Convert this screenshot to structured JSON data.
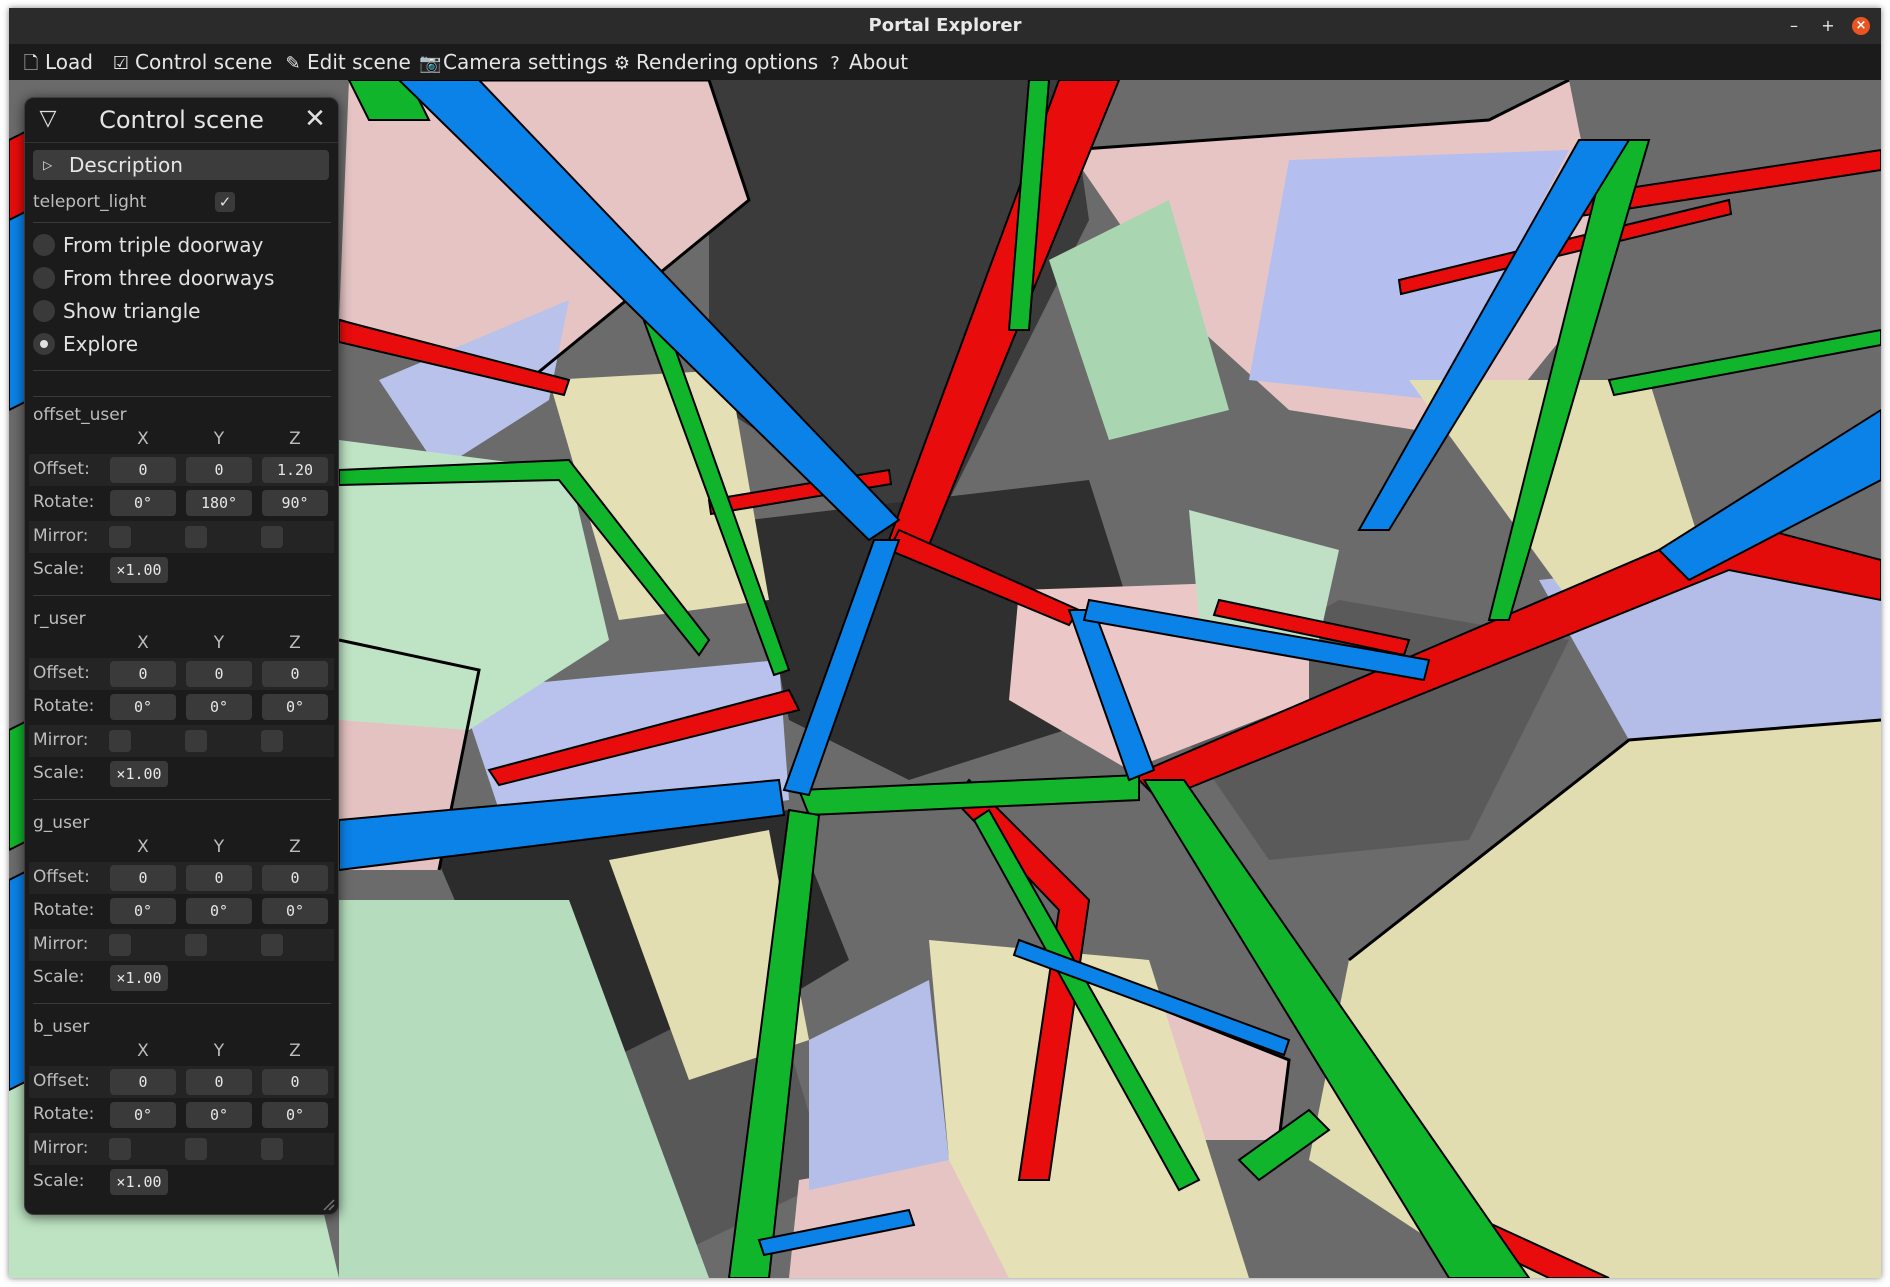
{
  "window": {
    "title": "Portal Explorer",
    "minimize_label": "–",
    "maximize_label": "+",
    "close_label": "×"
  },
  "menu": {
    "items": [
      {
        "label": "Load",
        "icon": "document-icon",
        "glyph": "🗋"
      },
      {
        "label": "Control scene",
        "icon": "checkbox-icon",
        "glyph": "☑"
      },
      {
        "label": "Edit scene",
        "icon": "pencil-icon",
        "glyph": "✎"
      },
      {
        "label": "Camera settings",
        "icon": "camera-icon",
        "glyph": "📷"
      },
      {
        "label": "Rendering options",
        "icon": "gear-icon",
        "glyph": "⚙"
      },
      {
        "label": "About",
        "icon": "question-icon",
        "glyph": "?"
      }
    ]
  },
  "panel": {
    "title": "Control scene",
    "collapse_glyph": "▽",
    "close_glyph": "✕",
    "description_label": "Description",
    "description_glyph": "▷",
    "teleport_light": {
      "label": "teleport_light",
      "checked": true,
      "glyph": "✓"
    },
    "radios": [
      {
        "label": "From triple doorway",
        "selected": false
      },
      {
        "label": "From three doorways",
        "selected": false
      },
      {
        "label": "Show triangle",
        "selected": false
      },
      {
        "label": "Explore",
        "selected": true
      }
    ],
    "axes": [
      "X",
      "Y",
      "Z"
    ],
    "row_labels": {
      "offset": "Offset:",
      "rotate": "Rotate:",
      "mirror": "Mirror:",
      "scale": "Scale:"
    },
    "sections": [
      {
        "name": "offset_user",
        "offset": [
          "0",
          "0",
          "1.20"
        ],
        "rotate": [
          "0°",
          "180°",
          "90°"
        ],
        "mirror": [
          false,
          false,
          false
        ],
        "scale": "×1.00"
      },
      {
        "name": "r_user",
        "offset": [
          "0",
          "0",
          "0"
        ],
        "rotate": [
          "0°",
          "0°",
          "0°"
        ],
        "mirror": [
          false,
          false,
          false
        ],
        "scale": "×1.00"
      },
      {
        "name": "g_user",
        "offset": [
          "0",
          "0",
          "0"
        ],
        "rotate": [
          "0°",
          "0°",
          "0°"
        ],
        "mirror": [
          false,
          false,
          false
        ],
        "scale": "×1.00"
      },
      {
        "name": "b_user",
        "offset": [
          "0",
          "0",
          "0"
        ],
        "rotate": [
          "0°",
          "0°",
          "0°"
        ],
        "mirror": [
          false,
          false,
          false
        ],
        "scale": "×1.00"
      }
    ]
  },
  "scene": {
    "colors": {
      "red": "#e80c0c",
      "green": "#11b52b",
      "blue": "#0a82e8",
      "pink": "#e8c6c6",
      "lavender": "#b6c0ea",
      "mint": "#bde6c4",
      "cream": "#e6e2b8",
      "dark_gray": "#3a3a3a",
      "mid_gray": "#6a6a6a"
    }
  }
}
